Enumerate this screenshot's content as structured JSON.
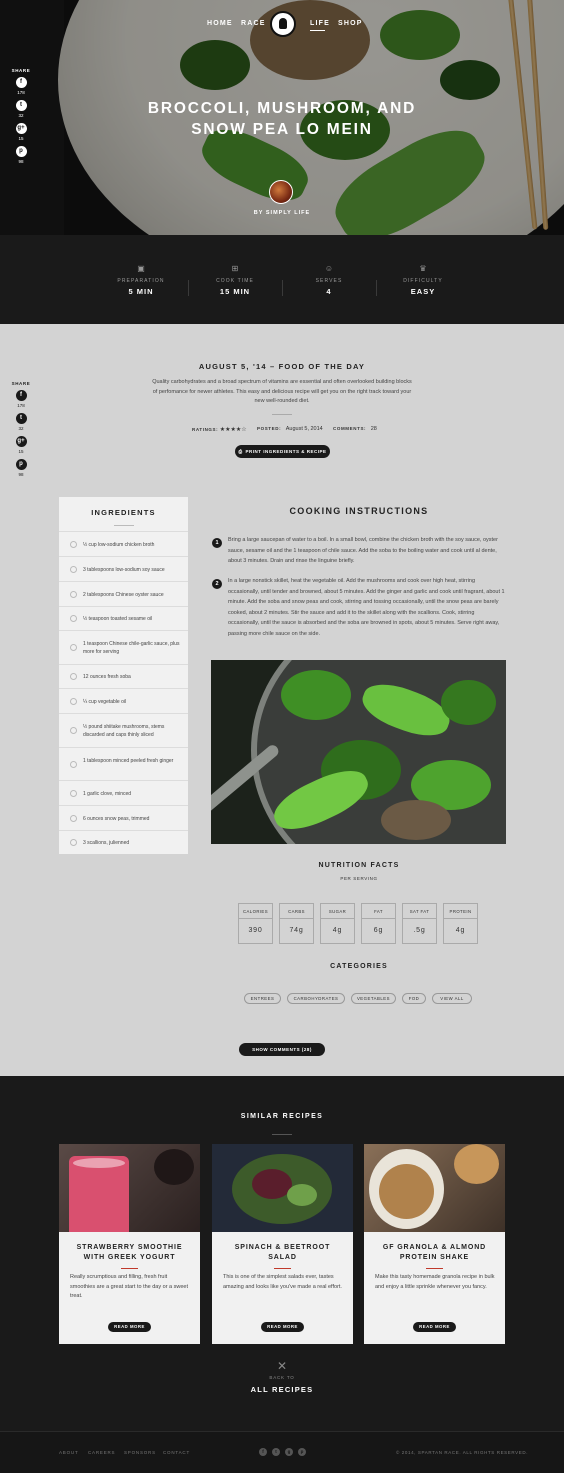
{
  "nav": {
    "home": "HOME",
    "race": "RACE",
    "life": "LIFE",
    "shop": "SHOP"
  },
  "hero": {
    "title_line1": "BROCCOLI, MUSHROOM, AND",
    "title_line2": "SNOW PEA LO MEIN",
    "byline": "BY SIMPLY LIFE"
  },
  "share": {
    "label": "SHARE",
    "items": [
      {
        "icon": "facebook-icon",
        "glyph": "f",
        "count": "178"
      },
      {
        "icon": "twitter-icon",
        "glyph": "t",
        "count": "32"
      },
      {
        "icon": "googleplus-icon",
        "glyph": "g+",
        "count": "15"
      },
      {
        "icon": "pinterest-icon",
        "glyph": "p",
        "count": "98"
      }
    ]
  },
  "stats": [
    {
      "label": "PREPARATION",
      "value": "5 MIN",
      "icon": "clipboard-icon",
      "glyph": "▣"
    },
    {
      "label": "COOK TIME",
      "value": "15 MIN",
      "icon": "stove-icon",
      "glyph": "⊞"
    },
    {
      "label": "SERVES",
      "value": "4",
      "icon": "people-icon",
      "glyph": "☺"
    },
    {
      "label": "DIFFICULTY",
      "value": "EASY",
      "icon": "chef-hat-icon",
      "glyph": "♛"
    }
  ],
  "post": {
    "date_heading": "AUGUST 5, '14 – FOOD OF THE DAY",
    "intro": "Quality carbohydrates and a broad spectrum of vitamins are essential and often overlooked building blocks of perfomance for newer athletes. This easy and delicious recipe will get you on the right track toward your new well-rounded diet.",
    "ratings_label": "RATINGS:",
    "stars": "★★★★☆",
    "rating_value": 4,
    "rating_max": 5,
    "posted_label": "POSTED:",
    "posted_value": "August 5, 2014",
    "comments_label": "COMMENTS:",
    "comments_value": "28",
    "print_button": "PRINT INGREDIENTS & RECIPE"
  },
  "ingredients": {
    "title": "INGREDIENTS",
    "items": [
      "½ cup low-sodium chicken broth",
      "3 tablespoons low-sodium soy sauce",
      "2 tablespoons Chinese oyster sauce",
      "½ teaspoon toasted sesame oil",
      "1 teaspoon Chinese chile-garlic sauce, plus more for serving",
      "12 ounces fresh soba",
      "¼ cup vegetable oil",
      "½ pound shiitake mushrooms, stems discarded and caps thinly sliced",
      "1 tablespoon minced peeled fresh ginger",
      "1 garlic clove, minced",
      "6 ounces snow peas, trimmed",
      "3 scallions, julienned"
    ]
  },
  "instructions": {
    "title": "COOKING INSTRUCTIONS",
    "steps": [
      {
        "num": "1",
        "text": "Bring a large saucepan of water to a boil. In a small bowl, combine the chicken broth with the soy sauce, oyster sauce, sesame oil and the 1 teaspoon of chile sauce. Add the soba to the boiling water and cook until al dente, about 3 minutes. Drain and rinse the linguine briefly."
      },
      {
        "num": "2",
        "text": "In a large nonstick skillet, heat the vegetable oil. Add the mushrooms and cook over high heat, stirring occasionally, until tender and browned, about 5 minutes. Add the ginger and garlic and cook until fragrant, about 1 minute. Add the soba and snow peas and cook, stirring and tossing occasionally, until the snow peas are barely cooked, about 2 minutes. Stir the sauce and add it to the skillet along with the scallions. Cook, stirring occasionally, until the sauce is absorbed and the soba are browned in spots, about 5 minutes. Serve right away, passing more chile sauce on the side."
      }
    ]
  },
  "nutrition": {
    "title": "NUTRITION FACTS",
    "subtitle": "PER SERVING",
    "items": [
      {
        "label": "CALORIES",
        "value": "390"
      },
      {
        "label": "CARBS",
        "value": "74g"
      },
      {
        "label": "SUGAR",
        "value": "4g"
      },
      {
        "label": "FAT",
        "value": "6g"
      },
      {
        "label": "SAT FAT",
        "value": ".5g"
      },
      {
        "label": "PROTEIN",
        "value": "4g"
      }
    ]
  },
  "categories": {
    "title": "CATEGORIES",
    "tags": [
      "ENTREES",
      "CARBOHYDRATES",
      "VEGETABLES",
      "FOD",
      "VIEW ALL"
    ]
  },
  "comments_button": "SHOW COMMENTS (28)",
  "similar": {
    "title": "SIMILAR RECIPES",
    "cards": [
      {
        "title": "STRAWBERRY SMOOTHIE WITH GREEK YOGURT",
        "desc": "Really scrumptious and filling, fresh fruit smoothies are a great start to the day or a sweet treat.",
        "button": "READ MORE"
      },
      {
        "title": "SPINACH & BEETROOT SALAD",
        "desc": "This is one of the simplest salads ever, tastes amazing and looks like you've made a real effort.",
        "button": "READ MORE"
      },
      {
        "title": "GF GRANOLA & ALMOND PROTEIN SHAKE",
        "desc": "Make this tasty homemade granola recipe in bulk and enjoy a little sprinkle whenever you fancy.",
        "button": "READ MORE"
      }
    ],
    "back_to": "BACK TO",
    "all_recipes": "ALL RECIPES",
    "close_glyph": "✕"
  },
  "footer": {
    "links": [
      "ABOUT",
      "CAREERS",
      "SPONSORS",
      "CONTACT"
    ],
    "social": [
      {
        "icon": "facebook-icon",
        "glyph": "f"
      },
      {
        "icon": "twitter-icon",
        "glyph": "t"
      },
      {
        "icon": "googleplus-icon",
        "glyph": "g"
      },
      {
        "icon": "pinterest-icon",
        "glyph": "p"
      }
    ],
    "copyright": "© 2014, SPARTAN RACE. ALL RIGHTS RESERVED."
  },
  "colors": {
    "accent_red": "#c0392b",
    "dark": "#1a1a1a",
    "page_bg": "#d3d3d3",
    "card_bg": "#f1f1f1"
  }
}
